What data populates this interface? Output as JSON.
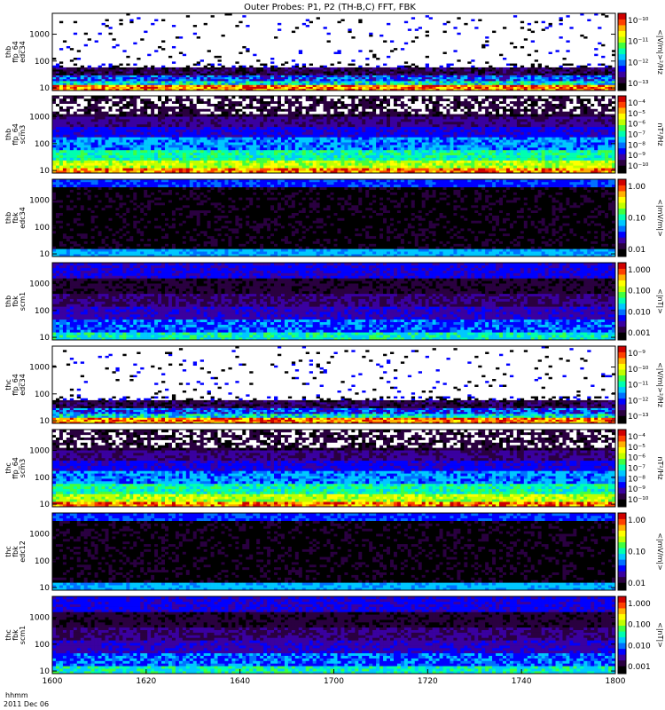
{
  "title": "Outer Probes: P1, P2 (TH-B,C) FFT, FBK",
  "footer": {
    "line1": "hhmm",
    "line2": "2011 Dec 06"
  },
  "colors": {
    "ramp": [
      "#000000",
      "#2a0040",
      "#3a00a0",
      "#0000ff",
      "#0070ff",
      "#00c8ff",
      "#00ffb0",
      "#40ff40",
      "#c0ff00",
      "#ffff00",
      "#ffb000",
      "#ff4000",
      "#d00000"
    ]
  },
  "chart_data": {
    "type": "heatmap",
    "x": {
      "ticks": [
        "1600",
        "1620",
        "1640",
        "1700",
        "1720",
        "1740",
        "1800"
      ]
    },
    "panels": [
      {
        "name": "thb ffp_64 edc34",
        "ylabel": [
          "thb",
          "ffp_64",
          "edc34"
        ],
        "yticks": [
          "10",
          "100",
          "1000"
        ],
        "cblabel": "<|V/m|>²/Hz",
        "cbticks": [
          "10⁻¹⁰",
          "10⁻¹¹",
          "10⁻¹²",
          "10⁻¹³"
        ],
        "style": "sparse"
      },
      {
        "name": "thb ffp_64 scm3",
        "ylabel": [
          "thb",
          "ffp_64",
          "scm3"
        ],
        "yticks": [
          "10",
          "100",
          "1000"
        ],
        "cblabel": "nT²/Hz",
        "cbticks": [
          "10⁻⁴",
          "10⁻⁵",
          "10⁻⁶",
          "10⁻⁷",
          "10⁻⁸",
          "10⁻⁹",
          "10⁻¹⁰"
        ],
        "style": "dense"
      },
      {
        "name": "thb fbk edc34",
        "ylabel": [
          "thb",
          "fbk",
          "edc34"
        ],
        "yticks": [
          "10",
          "100",
          "1000"
        ],
        "cblabel": "<|mV/m|>",
        "cbticks": [
          "1.00",
          "0.10",
          "0.01"
        ],
        "style": "fbk_e"
      },
      {
        "name": "thb fbk scm1",
        "ylabel": [
          "thb",
          "fbk",
          "scm1"
        ],
        "yticks": [
          "10",
          "100",
          "1000"
        ],
        "cblabel": "<|nT|>",
        "cbticks": [
          "1.000",
          "0.100",
          "0.010",
          "0.001"
        ],
        "style": "fbk_b"
      },
      {
        "name": "thc ffp_64 edc34",
        "ylabel": [
          "thc",
          "ffp_64",
          "edc34"
        ],
        "yticks": [
          "10",
          "100",
          "1000"
        ],
        "cblabel": "<|V/m|>²/Hz",
        "cbticks": [
          "10⁻⁹",
          "10⁻¹⁰",
          "10⁻¹¹",
          "10⁻¹²",
          "10⁻¹³"
        ],
        "style": "sparse"
      },
      {
        "name": "thc ffp_64 scm3",
        "ylabel": [
          "thc",
          "ffp_64",
          "scm3"
        ],
        "yticks": [
          "10",
          "100",
          "1000"
        ],
        "cblabel": "nT²/Hz",
        "cbticks": [
          "10⁻⁴",
          "10⁻⁵",
          "10⁻⁶",
          "10⁻⁷",
          "10⁻⁸",
          "10⁻⁹",
          "10⁻¹⁰"
        ],
        "style": "dense"
      },
      {
        "name": "thc fbk edc12",
        "ylabel": [
          "thc",
          "fbk",
          "edc12"
        ],
        "yticks": [
          "10",
          "100",
          "1000"
        ],
        "cblabel": "<|mV/m|>",
        "cbticks": [
          "1.00",
          "0.10",
          "0.01"
        ],
        "style": "fbk_e"
      },
      {
        "name": "thc fbk scm1",
        "ylabel": [
          "thc",
          "fbk",
          "scm1"
        ],
        "yticks": [
          "10",
          "100",
          "1000"
        ],
        "cblabel": "<|nT|>",
        "cbticks": [
          "1.000",
          "0.100",
          "0.010",
          "0.001"
        ],
        "style": "fbk_b"
      }
    ]
  }
}
